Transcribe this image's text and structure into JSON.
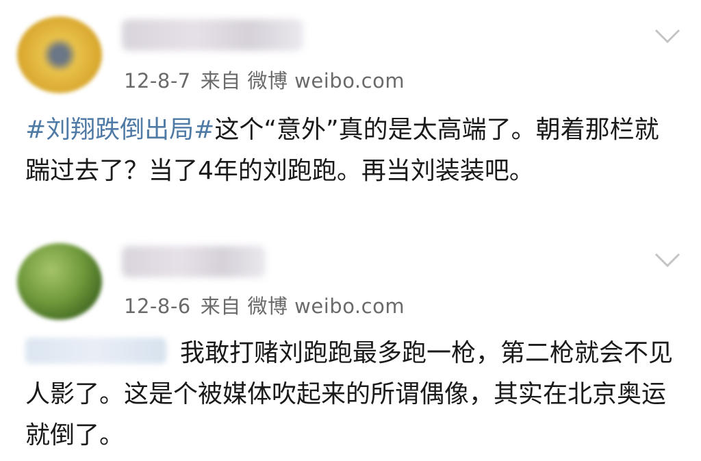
{
  "feed": {
    "posts": [
      {
        "username": "",
        "date": "12-8-7",
        "source": "来自 微博 weibo.com",
        "topic": "#刘翔跌倒出局#",
        "text": "这个“意外”真的是太高端了。朝着那栏就踹过去了？当了4年的刘跑跑。再当刘装装吧。"
      },
      {
        "username": "",
        "date": "12-8-6",
        "source": "来自 微博 weibo.com",
        "mention": "",
        "text": "我敢打赌刘跑跑最多跑一枪，第二枪就会不见人影了。这是个被媒体吹起来的所谓偶像，其实在北京奥运就倒了。"
      }
    ]
  },
  "icons": {
    "expand": "chevron-down-icon"
  },
  "colors": {
    "topic_link": "#4f7aa6",
    "meta_text": "#6a6a6a",
    "body_text": "#1a1a1a",
    "avatar_1": "#d9a82e",
    "avatar_2": "#6f9a3b"
  }
}
